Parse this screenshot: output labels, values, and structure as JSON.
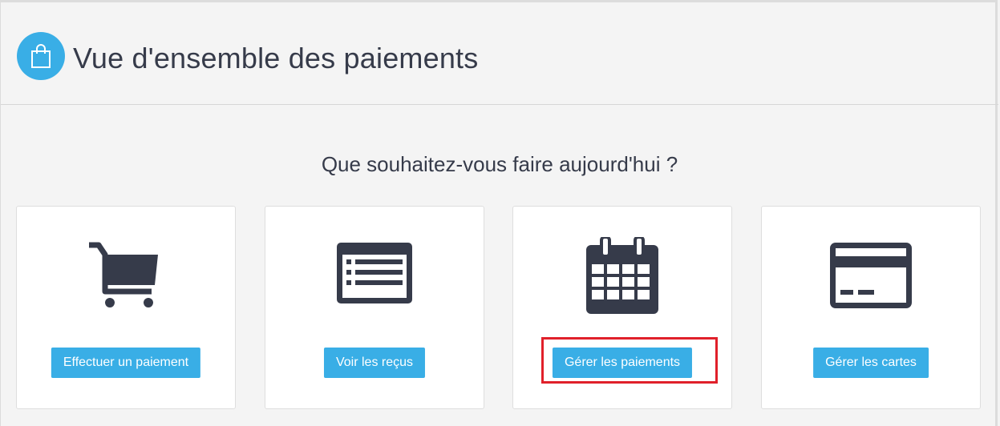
{
  "header": {
    "title": "Vue d'ensemble des paiements",
    "icon": "shopping-bag-icon",
    "icon_color": "#39aee6"
  },
  "prompt": "Que souhaitez-vous faire aujourd'hui ?",
  "cards": [
    {
      "icon": "shopping-cart-icon",
      "button_label": "Effectuer un paiement"
    },
    {
      "icon": "receipt-list-icon",
      "button_label": "Voir les reçus"
    },
    {
      "icon": "calendar-icon",
      "button_label": "Gérer les paiements",
      "highlighted": true
    },
    {
      "icon": "credit-card-icon",
      "button_label": "Gérer les cartes"
    }
  ],
  "colors": {
    "accent": "#39aee6",
    "icon": "#363b4a",
    "highlight": "#e0202a",
    "background": "#f4f4f4"
  }
}
